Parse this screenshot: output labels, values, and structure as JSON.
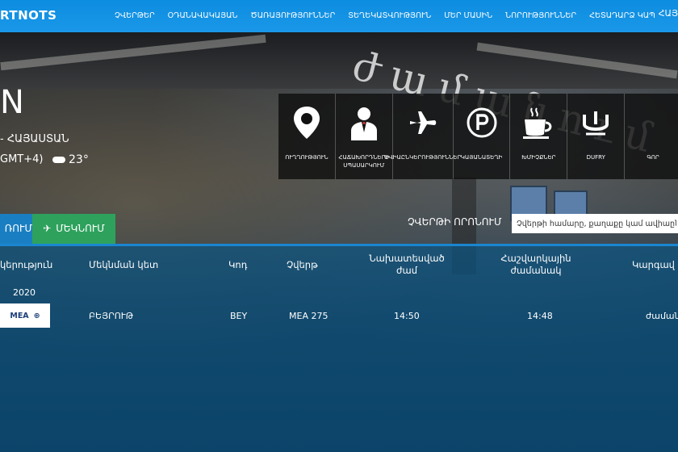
{
  "header": {
    "logo": "RTNOTS",
    "nav": [
      "ՉՎԵՐԹԵՐ",
      "ՕԴԱՆԱՎԱԿԱՅԱՆ",
      "ԾԱՌԱՅՈՒԹՅՈՒՆՆԵՐ",
      "ՏԵՂԵԿԱՏՎՈՒԹՅՈՒՆ",
      "ՄԵՐ ՄԱՍԻՆ",
      "ՆՈՐՈՒԹՅՈՒՆՆԵՐ",
      "ՀԵՏԱԴԱՐՁ ԿԱՊ"
    ],
    "lang": "ՀԱՅ"
  },
  "hero": {
    "sign_text": "ժամանում",
    "city_partial": "N",
    "country": "- ՀԱՅԱՍՏԱՆ",
    "timezone": "GMT+4)",
    "temperature": "23°"
  },
  "services": [
    {
      "label": "ՈՒՂՂՈՒԹՅՈՒՆ",
      "icon": "location-pin-icon"
    },
    {
      "label": "ՀԱՃԱԽՈՐԴՆԵՐԻ ՍՊԱՍԱՐԿՈՒՄ",
      "icon": "passenger-service-icon"
    },
    {
      "label": "ԱՎԻԱԸՆԿԵՐՈՒԹՅՈՒՆՆԵՐ",
      "icon": "airplane-icon"
    },
    {
      "label": "ԿԱՅԱՆԱՏԵՂԻ",
      "icon": "parking-icon"
    },
    {
      "label": "ԽՄԻՉՔՆԵՐ",
      "icon": "coffee-cup-icon"
    },
    {
      "label": "DUFRY",
      "icon": "dufry-icon"
    },
    {
      "label": "ԳՈՐ",
      "icon": "more-icon"
    }
  ],
  "tabs": {
    "arrivals": "ՌՈՒՄ",
    "departures": "ՄԵԿՆՈՒՄ"
  },
  "search": {
    "label": "ՉՎԵՐԹԻ ՈՐՈՆՈՒՄ",
    "placeholder": "Չվերթի համարը, քաղաքը կամ ավիաընկ"
  },
  "table": {
    "headers": {
      "airline": "կերություն",
      "departure_point": "Մեկնման կետ",
      "code": "Կոդ",
      "flight": "Չվերթ",
      "scheduled": [
        "Նախատեսված",
        "ժամ"
      ],
      "estimated": [
        "Հաշվարկային",
        "ժամանակ"
      ],
      "status": "Կարգավ"
    },
    "date": "2020",
    "rows": [
      {
        "airline_logo": "MEA",
        "departure_point": "ԲԵՅՐՈՒԹ",
        "code": "BEY",
        "flight": "MEA 275",
        "scheduled": "14:50",
        "estimated": "14:48",
        "status": "ժամանե"
      }
    ]
  },
  "colors": {
    "header_blue": "#1a97e8",
    "departures_green": "#2ea25d",
    "arrivals_blue": "#1a7fc2"
  }
}
